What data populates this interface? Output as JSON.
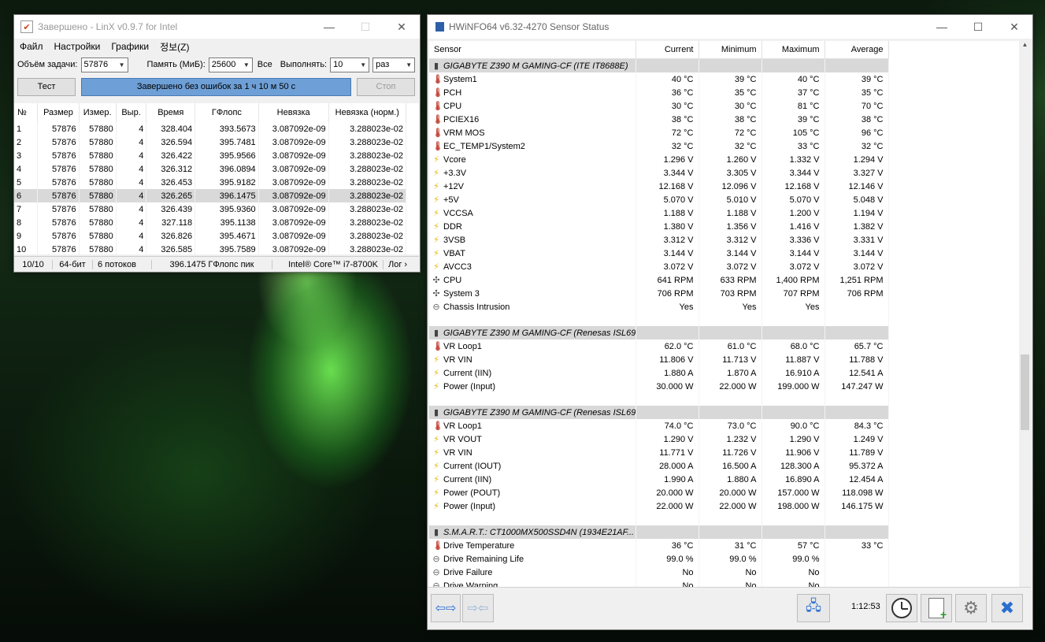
{
  "linx": {
    "title": "Завершено - LinX v0.9.7 for Intel",
    "menu": [
      "Файл",
      "Настройки",
      "Графики",
      "정보(Z)"
    ],
    "problem_size_label": "Объём задачи:",
    "problem_size_value": "57876",
    "memory_label": "Память (МиБ):",
    "memory_value": "25600",
    "all_label": "Все",
    "runs_label": "Выполнять:",
    "runs_value": "10",
    "runs_unit": "раз",
    "test_button": "Тест",
    "progress_text": "Завершено без ошибок за 1 ч 10 м 50 с",
    "stop_button": "Стоп",
    "columns": [
      "№",
      "Размер",
      "Измер.",
      "Выр.",
      "Время",
      "ГФлопс",
      "Невязка",
      "Невязка (норм.)"
    ],
    "rows": [
      [
        "1",
        "57876",
        "57880",
        "4",
        "328.404",
        "393.5673",
        "3.087092e-09",
        "3.288023e-02"
      ],
      [
        "2",
        "57876",
        "57880",
        "4",
        "326.594",
        "395.7481",
        "3.087092e-09",
        "3.288023e-02"
      ],
      [
        "3",
        "57876",
        "57880",
        "4",
        "326.422",
        "395.9566",
        "3.087092e-09",
        "3.288023e-02"
      ],
      [
        "4",
        "57876",
        "57880",
        "4",
        "326.312",
        "396.0894",
        "3.087092e-09",
        "3.288023e-02"
      ],
      [
        "5",
        "57876",
        "57880",
        "4",
        "326.453",
        "395.9182",
        "3.087092e-09",
        "3.288023e-02"
      ],
      [
        "6",
        "57876",
        "57880",
        "4",
        "326.265",
        "396.1475",
        "3.087092e-09",
        "3.288023e-02"
      ],
      [
        "7",
        "57876",
        "57880",
        "4",
        "326.439",
        "395.9360",
        "3.087092e-09",
        "3.288023e-02"
      ],
      [
        "8",
        "57876",
        "57880",
        "4",
        "327.118",
        "395.1138",
        "3.087092e-09",
        "3.288023e-02"
      ],
      [
        "9",
        "57876",
        "57880",
        "4",
        "326.826",
        "395.4671",
        "3.087092e-09",
        "3.288023e-02"
      ],
      [
        "10",
        "57876",
        "57880",
        "4",
        "326.585",
        "395.7589",
        "3.087092e-09",
        "3.288023e-02"
      ]
    ],
    "selected_row": 6,
    "status": [
      "10/10",
      "64-бит",
      "6 потоков",
      "396.1475 ГФлопс пик",
      "Intel® Core™ i7-8700K",
      "Лог ›"
    ]
  },
  "hwinfo": {
    "title": "HWiNFO64 v6.32-4270 Sensor Status",
    "columns": [
      "Sensor",
      "Current",
      "Minimum",
      "Maximum",
      "Average"
    ],
    "groups": [
      {
        "name": "GIGABYTE Z390 M GAMING-CF (ITE IT8688E)",
        "rows": [
          {
            "icon": "thermometer-icon",
            "name": "System1",
            "cur": "40 °C",
            "min": "39 °C",
            "max": "40 °C",
            "avg": "39 °C"
          },
          {
            "icon": "thermometer-icon",
            "name": "PCH",
            "cur": "36 °C",
            "min": "35 °C",
            "max": "37 °C",
            "avg": "35 °C"
          },
          {
            "icon": "thermometer-icon",
            "name": "CPU",
            "cur": "30 °C",
            "min": "30 °C",
            "max": "81 °C",
            "avg": "70 °C"
          },
          {
            "icon": "thermometer-icon",
            "name": "PCIEX16",
            "cur": "38 °C",
            "min": "38 °C",
            "max": "39 °C",
            "avg": "38 °C"
          },
          {
            "icon": "thermometer-icon",
            "name": "VRM MOS",
            "cur": "72 °C",
            "min": "72 °C",
            "max": "105 °C",
            "avg": "96 °C"
          },
          {
            "icon": "thermometer-icon",
            "name": "EC_TEMP1/System2",
            "cur": "32 °C",
            "min": "32 °C",
            "max": "33 °C",
            "avg": "32 °C"
          },
          {
            "icon": "voltage-icon",
            "name": "Vcore",
            "cur": "1.296 V",
            "min": "1.260 V",
            "max": "1.332 V",
            "avg": "1.294 V"
          },
          {
            "icon": "voltage-icon",
            "name": "+3.3V",
            "cur": "3.344 V",
            "min": "3.305 V",
            "max": "3.344 V",
            "avg": "3.327 V"
          },
          {
            "icon": "voltage-icon",
            "name": "+12V",
            "cur": "12.168 V",
            "min": "12.096 V",
            "max": "12.168 V",
            "avg": "12.146 V"
          },
          {
            "icon": "voltage-icon",
            "name": "+5V",
            "cur": "5.070 V",
            "min": "5.010 V",
            "max": "5.070 V",
            "avg": "5.048 V"
          },
          {
            "icon": "voltage-icon",
            "name": "VCCSA",
            "cur": "1.188 V",
            "min": "1.188 V",
            "max": "1.200 V",
            "avg": "1.194 V"
          },
          {
            "icon": "voltage-icon",
            "name": "DDR",
            "cur": "1.380 V",
            "min": "1.356 V",
            "max": "1.416 V",
            "avg": "1.382 V"
          },
          {
            "icon": "voltage-icon",
            "name": "3VSB",
            "cur": "3.312 V",
            "min": "3.312 V",
            "max": "3.336 V",
            "avg": "3.331 V"
          },
          {
            "icon": "voltage-icon",
            "name": "VBAT",
            "cur": "3.144 V",
            "min": "3.144 V",
            "max": "3.144 V",
            "avg": "3.144 V"
          },
          {
            "icon": "voltage-icon",
            "name": "AVCC3",
            "cur": "3.072 V",
            "min": "3.072 V",
            "max": "3.072 V",
            "avg": "3.072 V"
          },
          {
            "icon": "fan-icon",
            "name": "CPU",
            "cur": "641 RPM",
            "min": "633 RPM",
            "max": "1,400 RPM",
            "avg": "1,251 RPM"
          },
          {
            "icon": "fan-icon",
            "name": "System 3",
            "cur": "706 RPM",
            "min": "703 RPM",
            "max": "707 RPM",
            "avg": "706 RPM"
          },
          {
            "icon": "status-icon",
            "name": "Chassis Intrusion",
            "cur": "Yes",
            "min": "Yes",
            "max": "Yes",
            "avg": ""
          }
        ]
      },
      {
        "name": "GIGABYTE Z390 M GAMING-CF (Renesas ISL69...",
        "rows": [
          {
            "icon": "thermometer-icon",
            "name": "VR Loop1",
            "cur": "62.0 °C",
            "min": "61.0 °C",
            "max": "68.0 °C",
            "avg": "65.7 °C"
          },
          {
            "icon": "voltage-icon",
            "name": "VR VIN",
            "cur": "11.806 V",
            "min": "11.713 V",
            "max": "11.887 V",
            "avg": "11.788 V"
          },
          {
            "icon": "voltage-icon",
            "name": "Current (IIN)",
            "cur": "1.880 A",
            "min": "1.870 A",
            "max": "16.910 A",
            "avg": "12.541 A"
          },
          {
            "icon": "voltage-icon",
            "name": "Power (Input)",
            "cur": "30.000 W",
            "min": "22.000 W",
            "max": "199.000 W",
            "avg": "147.247 W"
          }
        ]
      },
      {
        "name": "GIGABYTE Z390 M GAMING-CF (Renesas ISL69...",
        "rows": [
          {
            "icon": "thermometer-icon",
            "name": "VR Loop1",
            "cur": "74.0 °C",
            "min": "73.0 °C",
            "max": "90.0 °C",
            "avg": "84.3 °C"
          },
          {
            "icon": "voltage-icon",
            "name": "VR VOUT",
            "cur": "1.290 V",
            "min": "1.232 V",
            "max": "1.290 V",
            "avg": "1.249 V"
          },
          {
            "icon": "voltage-icon",
            "name": "VR VIN",
            "cur": "11.771 V",
            "min": "11.726 V",
            "max": "11.906 V",
            "avg": "11.789 V"
          },
          {
            "icon": "voltage-icon",
            "name": "Current (IOUT)",
            "cur": "28.000 A",
            "min": "16.500 A",
            "max": "128.300 A",
            "avg": "95.372 A"
          },
          {
            "icon": "voltage-icon",
            "name": "Current (IIN)",
            "cur": "1.990 A",
            "min": "1.880 A",
            "max": "16.890 A",
            "avg": "12.454 A"
          },
          {
            "icon": "voltage-icon",
            "name": "Power (POUT)",
            "cur": "20.000 W",
            "min": "20.000 W",
            "max": "157.000 W",
            "avg": "118.098 W"
          },
          {
            "icon": "voltage-icon",
            "name": "Power (Input)",
            "cur": "22.000 W",
            "min": "22.000 W",
            "max": "198.000 W",
            "avg": "146.175 W"
          }
        ]
      },
      {
        "name": "S.M.A.R.T.: CT1000MX500SSD4N (1934E21AF...",
        "rows": [
          {
            "icon": "thermometer-icon",
            "name": "Drive Temperature",
            "cur": "36 °C",
            "min": "31 °C",
            "max": "57 °C",
            "avg": "33 °C"
          },
          {
            "icon": "status-icon",
            "name": "Drive Remaining Life",
            "cur": "99.0 %",
            "min": "99.0 %",
            "max": "99.0 %",
            "avg": ""
          },
          {
            "icon": "status-icon",
            "name": "Drive Failure",
            "cur": "No",
            "min": "No",
            "max": "No",
            "avg": ""
          },
          {
            "icon": "status-icon",
            "name": "Drive Warning",
            "cur": "No",
            "min": "No",
            "max": "No",
            "avg": ""
          }
        ]
      }
    ],
    "elapsed_time": "1:12:53"
  }
}
